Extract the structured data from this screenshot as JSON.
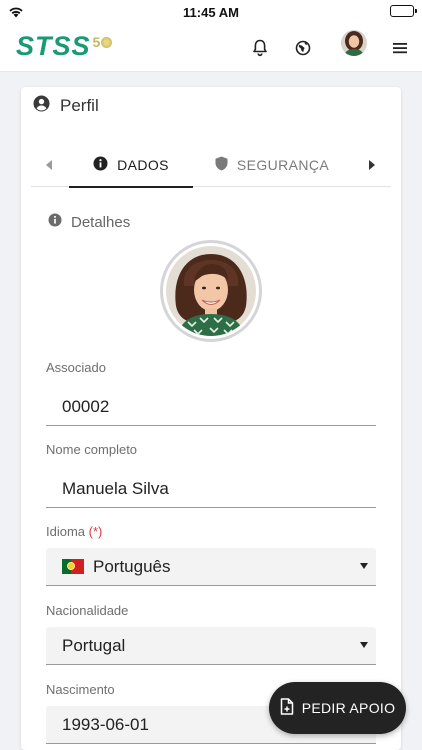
{
  "status_bar": {
    "time": "11:45 AM"
  },
  "app_bar": {
    "logo_text": "STSS",
    "logo_badge": "5"
  },
  "card": {
    "title": "Perfil",
    "tabs": [
      {
        "label": "DADOS",
        "active": true
      },
      {
        "label": "SEGURANÇA",
        "active": false
      }
    ],
    "section_title": "Detalhes",
    "fields": {
      "associado": {
        "label": "Associado",
        "value": "00002"
      },
      "nome": {
        "label": "Nome completo",
        "value": "Manuela Silva"
      },
      "idioma": {
        "label": "Idioma",
        "required_mark": "(*)",
        "value": "Português"
      },
      "nacionalidade": {
        "label": "Nacionalidade",
        "value": "Portugal"
      },
      "nascimento": {
        "label": "Nascimento",
        "value": "1993-06-01"
      }
    }
  },
  "fab": {
    "label": "PEDIR APOIO"
  },
  "colors": {
    "brand": "#1a9a73",
    "accent_dark": "#232323",
    "required": "#d83b3b"
  }
}
